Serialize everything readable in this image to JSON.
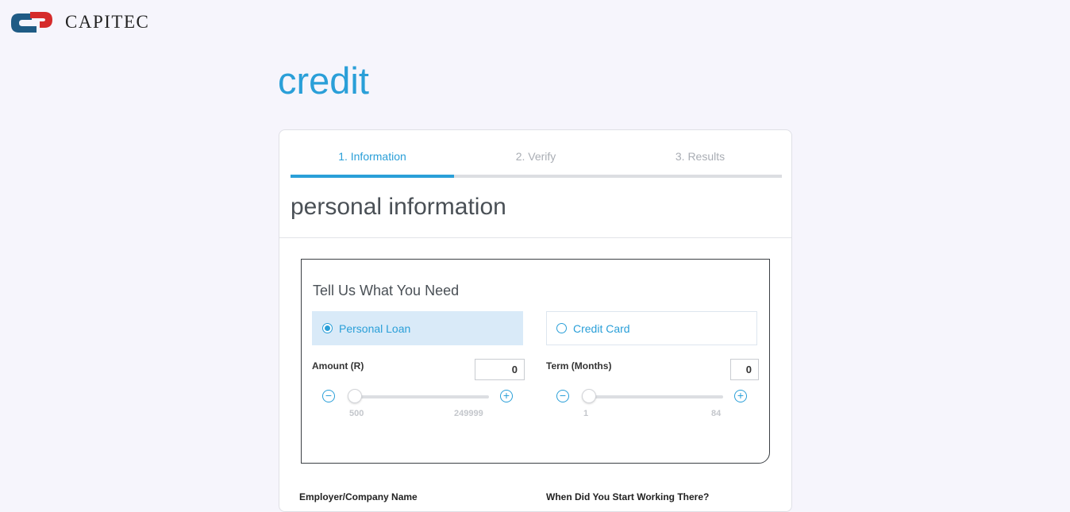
{
  "brand": {
    "name": "CAPITEC",
    "colors": {
      "blue": "#1f5b85",
      "red": "#d52b2b",
      "accent": "#2a9fd8"
    }
  },
  "page": {
    "title": "credit"
  },
  "steps": [
    {
      "label": "1. Information",
      "active": true
    },
    {
      "label": "2. Verify",
      "active": false
    },
    {
      "label": "3. Results",
      "active": false
    }
  ],
  "section": {
    "title": "personal information"
  },
  "need": {
    "title": "Tell Us What You Need",
    "options": [
      {
        "label": "Personal Loan",
        "selected": true
      },
      {
        "label": "Credit Card",
        "selected": false
      }
    ],
    "amount": {
      "label": "Amount (R)",
      "value": "0",
      "min": "500",
      "max": "249999",
      "minus_icon": "minus-circle-icon",
      "plus_icon": "plus-circle-icon"
    },
    "term": {
      "label": "Term (Months)",
      "value": "0",
      "min": "1",
      "max": "84",
      "minus_icon": "minus-circle-icon",
      "plus_icon": "plus-circle-icon"
    }
  },
  "form": {
    "employer_label": "Employer/Company Name",
    "start_label": "When Did You Start Working There?"
  }
}
